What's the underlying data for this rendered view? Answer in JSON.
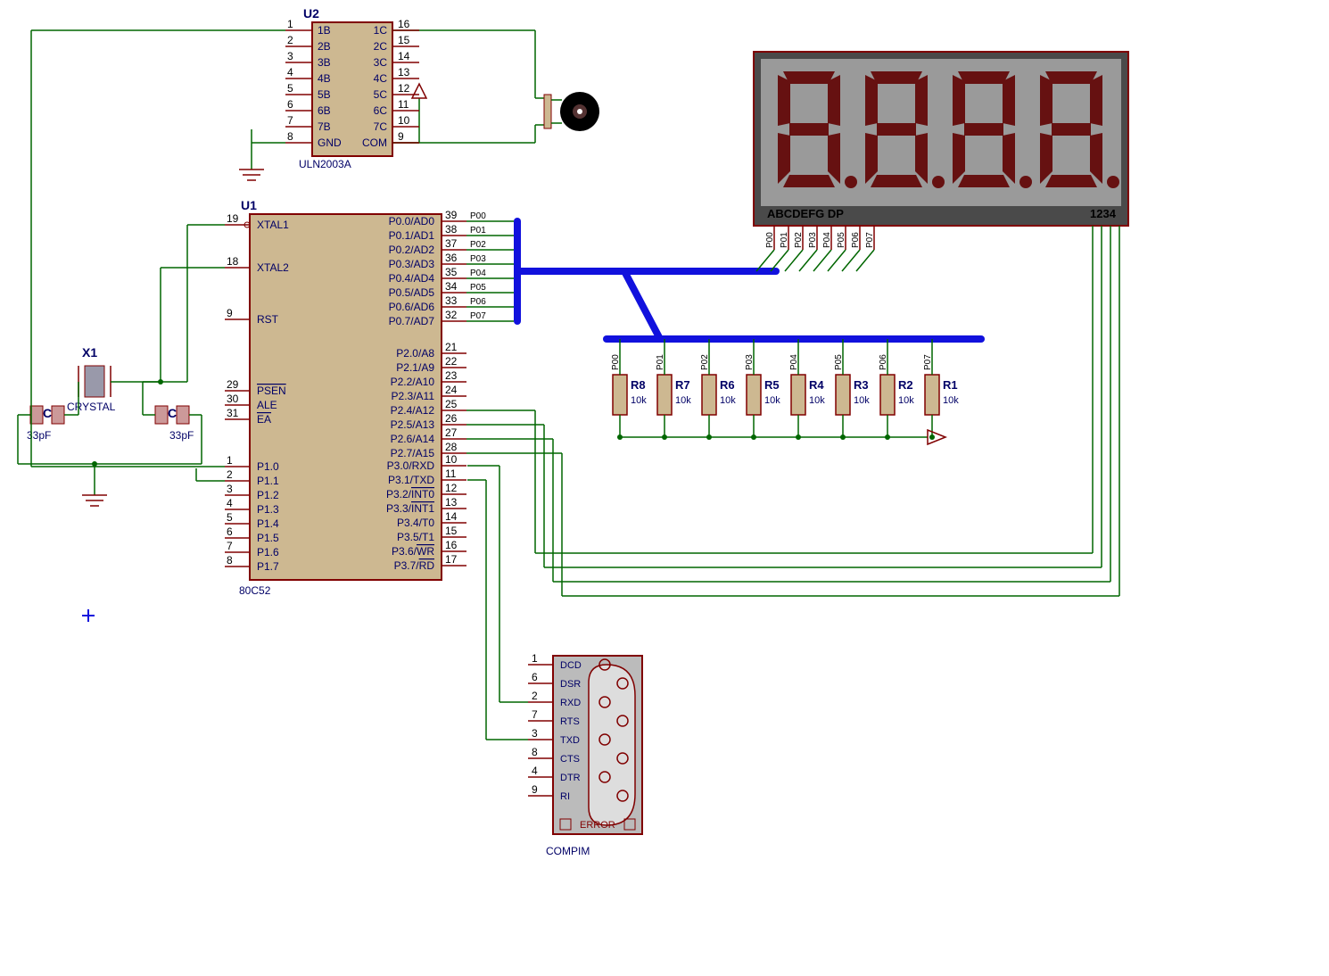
{
  "u1": {
    "ref": "U1",
    "part": "80C52",
    "left_pins": [
      {
        "num": "19",
        "name": "XTAL1"
      },
      {
        "num": "18",
        "name": "XTAL2"
      },
      {
        "num": "9",
        "name": "RST"
      },
      {
        "num": "29",
        "name": "PSEN",
        "ov": true
      },
      {
        "num": "30",
        "name": "ALE"
      },
      {
        "num": "31",
        "name": "EA",
        "ov": true
      },
      {
        "num": "1",
        "name": "P1.0"
      },
      {
        "num": "2",
        "name": "P1.1"
      },
      {
        "num": "3",
        "name": "P1.2"
      },
      {
        "num": "4",
        "name": "P1.3"
      },
      {
        "num": "5",
        "name": "P1.4"
      },
      {
        "num": "6",
        "name": "P1.5"
      },
      {
        "num": "7",
        "name": "P1.6"
      },
      {
        "num": "8",
        "name": "P1.7"
      }
    ],
    "right_pins": [
      {
        "num": "39",
        "name": "P0.0/AD0"
      },
      {
        "num": "38",
        "name": "P0.1/AD1"
      },
      {
        "num": "37",
        "name": "P0.2/AD2"
      },
      {
        "num": "36",
        "name": "P0.3/AD3"
      },
      {
        "num": "35",
        "name": "P0.4/AD4"
      },
      {
        "num": "34",
        "name": "P0.5/AD5"
      },
      {
        "num": "33",
        "name": "P0.6/AD6"
      },
      {
        "num": "32",
        "name": "P0.7/AD7"
      },
      {
        "num": "21",
        "name": "P2.0/A8"
      },
      {
        "num": "22",
        "name": "P2.1/A9"
      },
      {
        "num": "23",
        "name": "P2.2/A10"
      },
      {
        "num": "24",
        "name": "P2.3/A11"
      },
      {
        "num": "25",
        "name": "P2.4/A12"
      },
      {
        "num": "26",
        "name": "P2.5/A13"
      },
      {
        "num": "27",
        "name": "P2.6/A14"
      },
      {
        "num": "28",
        "name": "P2.7/A15"
      },
      {
        "num": "10",
        "name": "P3.0/RXD"
      },
      {
        "num": "11",
        "name": "P3.1/TXD"
      },
      {
        "num": "12",
        "name": "P3.2/INT0",
        "ovpart": "INT0"
      },
      {
        "num": "13",
        "name": "P3.3/INT1",
        "ovpart": "INT1"
      },
      {
        "num": "14",
        "name": "P3.4/T0"
      },
      {
        "num": "15",
        "name": "P3.5/T1"
      },
      {
        "num": "16",
        "name": "P3.6/WR",
        "ovpart": "WR"
      },
      {
        "num": "17",
        "name": "P3.7/RD",
        "ovpart": "RD"
      }
    ]
  },
  "u2": {
    "ref": "U2",
    "part": "ULN2003A",
    "left": [
      {
        "num": "1",
        "name": "1B"
      },
      {
        "num": "2",
        "name": "2B"
      },
      {
        "num": "3",
        "name": "3B"
      },
      {
        "num": "4",
        "name": "4B"
      },
      {
        "num": "5",
        "name": "5B"
      },
      {
        "num": "6",
        "name": "6B"
      },
      {
        "num": "7",
        "name": "7B"
      },
      {
        "num": "8",
        "name": "GND"
      }
    ],
    "right": [
      {
        "num": "16",
        "name": "1C"
      },
      {
        "num": "15",
        "name": "2C"
      },
      {
        "num": "14",
        "name": "3C"
      },
      {
        "num": "13",
        "name": "4C"
      },
      {
        "num": "12",
        "name": "5C"
      },
      {
        "num": "11",
        "name": "6C"
      },
      {
        "num": "10",
        "name": "7C"
      },
      {
        "num": "9",
        "name": "COM"
      }
    ]
  },
  "xtal": {
    "ref": "X1",
    "val": "CRYSTAL"
  },
  "c1": {
    "ref": "C1",
    "val": "33pF"
  },
  "c2": {
    "ref": "C2",
    "val": "33pF"
  },
  "resistors": [
    {
      "ref": "R8",
      "val": "10k",
      "net": "P00"
    },
    {
      "ref": "R7",
      "val": "10k",
      "net": "P01"
    },
    {
      "ref": "R6",
      "val": "10k",
      "net": "P02"
    },
    {
      "ref": "R5",
      "val": "10k",
      "net": "P03"
    },
    {
      "ref": "R4",
      "val": "10k",
      "net": "P04"
    },
    {
      "ref": "R3",
      "val": "10k",
      "net": "P05"
    },
    {
      "ref": "R2",
      "val": "10k",
      "net": "P06"
    },
    {
      "ref": "R1",
      "val": "10k",
      "net": "P07"
    }
  ],
  "display": {
    "pins": "ABCDEFG  DP",
    "anodes": "1234",
    "nets": [
      "P00",
      "P01",
      "P02",
      "P03",
      "P04",
      "P05",
      "P06",
      "P07"
    ]
  },
  "compim": {
    "part": "COMPIM",
    "err": "ERROR",
    "pins": [
      {
        "num": "1",
        "name": "DCD"
      },
      {
        "num": "6",
        "name": "DSR"
      },
      {
        "num": "2",
        "name": "RXD"
      },
      {
        "num": "7",
        "name": "RTS"
      },
      {
        "num": "3",
        "name": "TXD"
      },
      {
        "num": "8",
        "name": "CTS"
      },
      {
        "num": "4",
        "name": "DTR"
      },
      {
        "num": "9",
        "name": "RI"
      }
    ]
  },
  "busnets": [
    "P00",
    "P01",
    "P02",
    "P03",
    "P04",
    "P05",
    "P06",
    "P07"
  ]
}
